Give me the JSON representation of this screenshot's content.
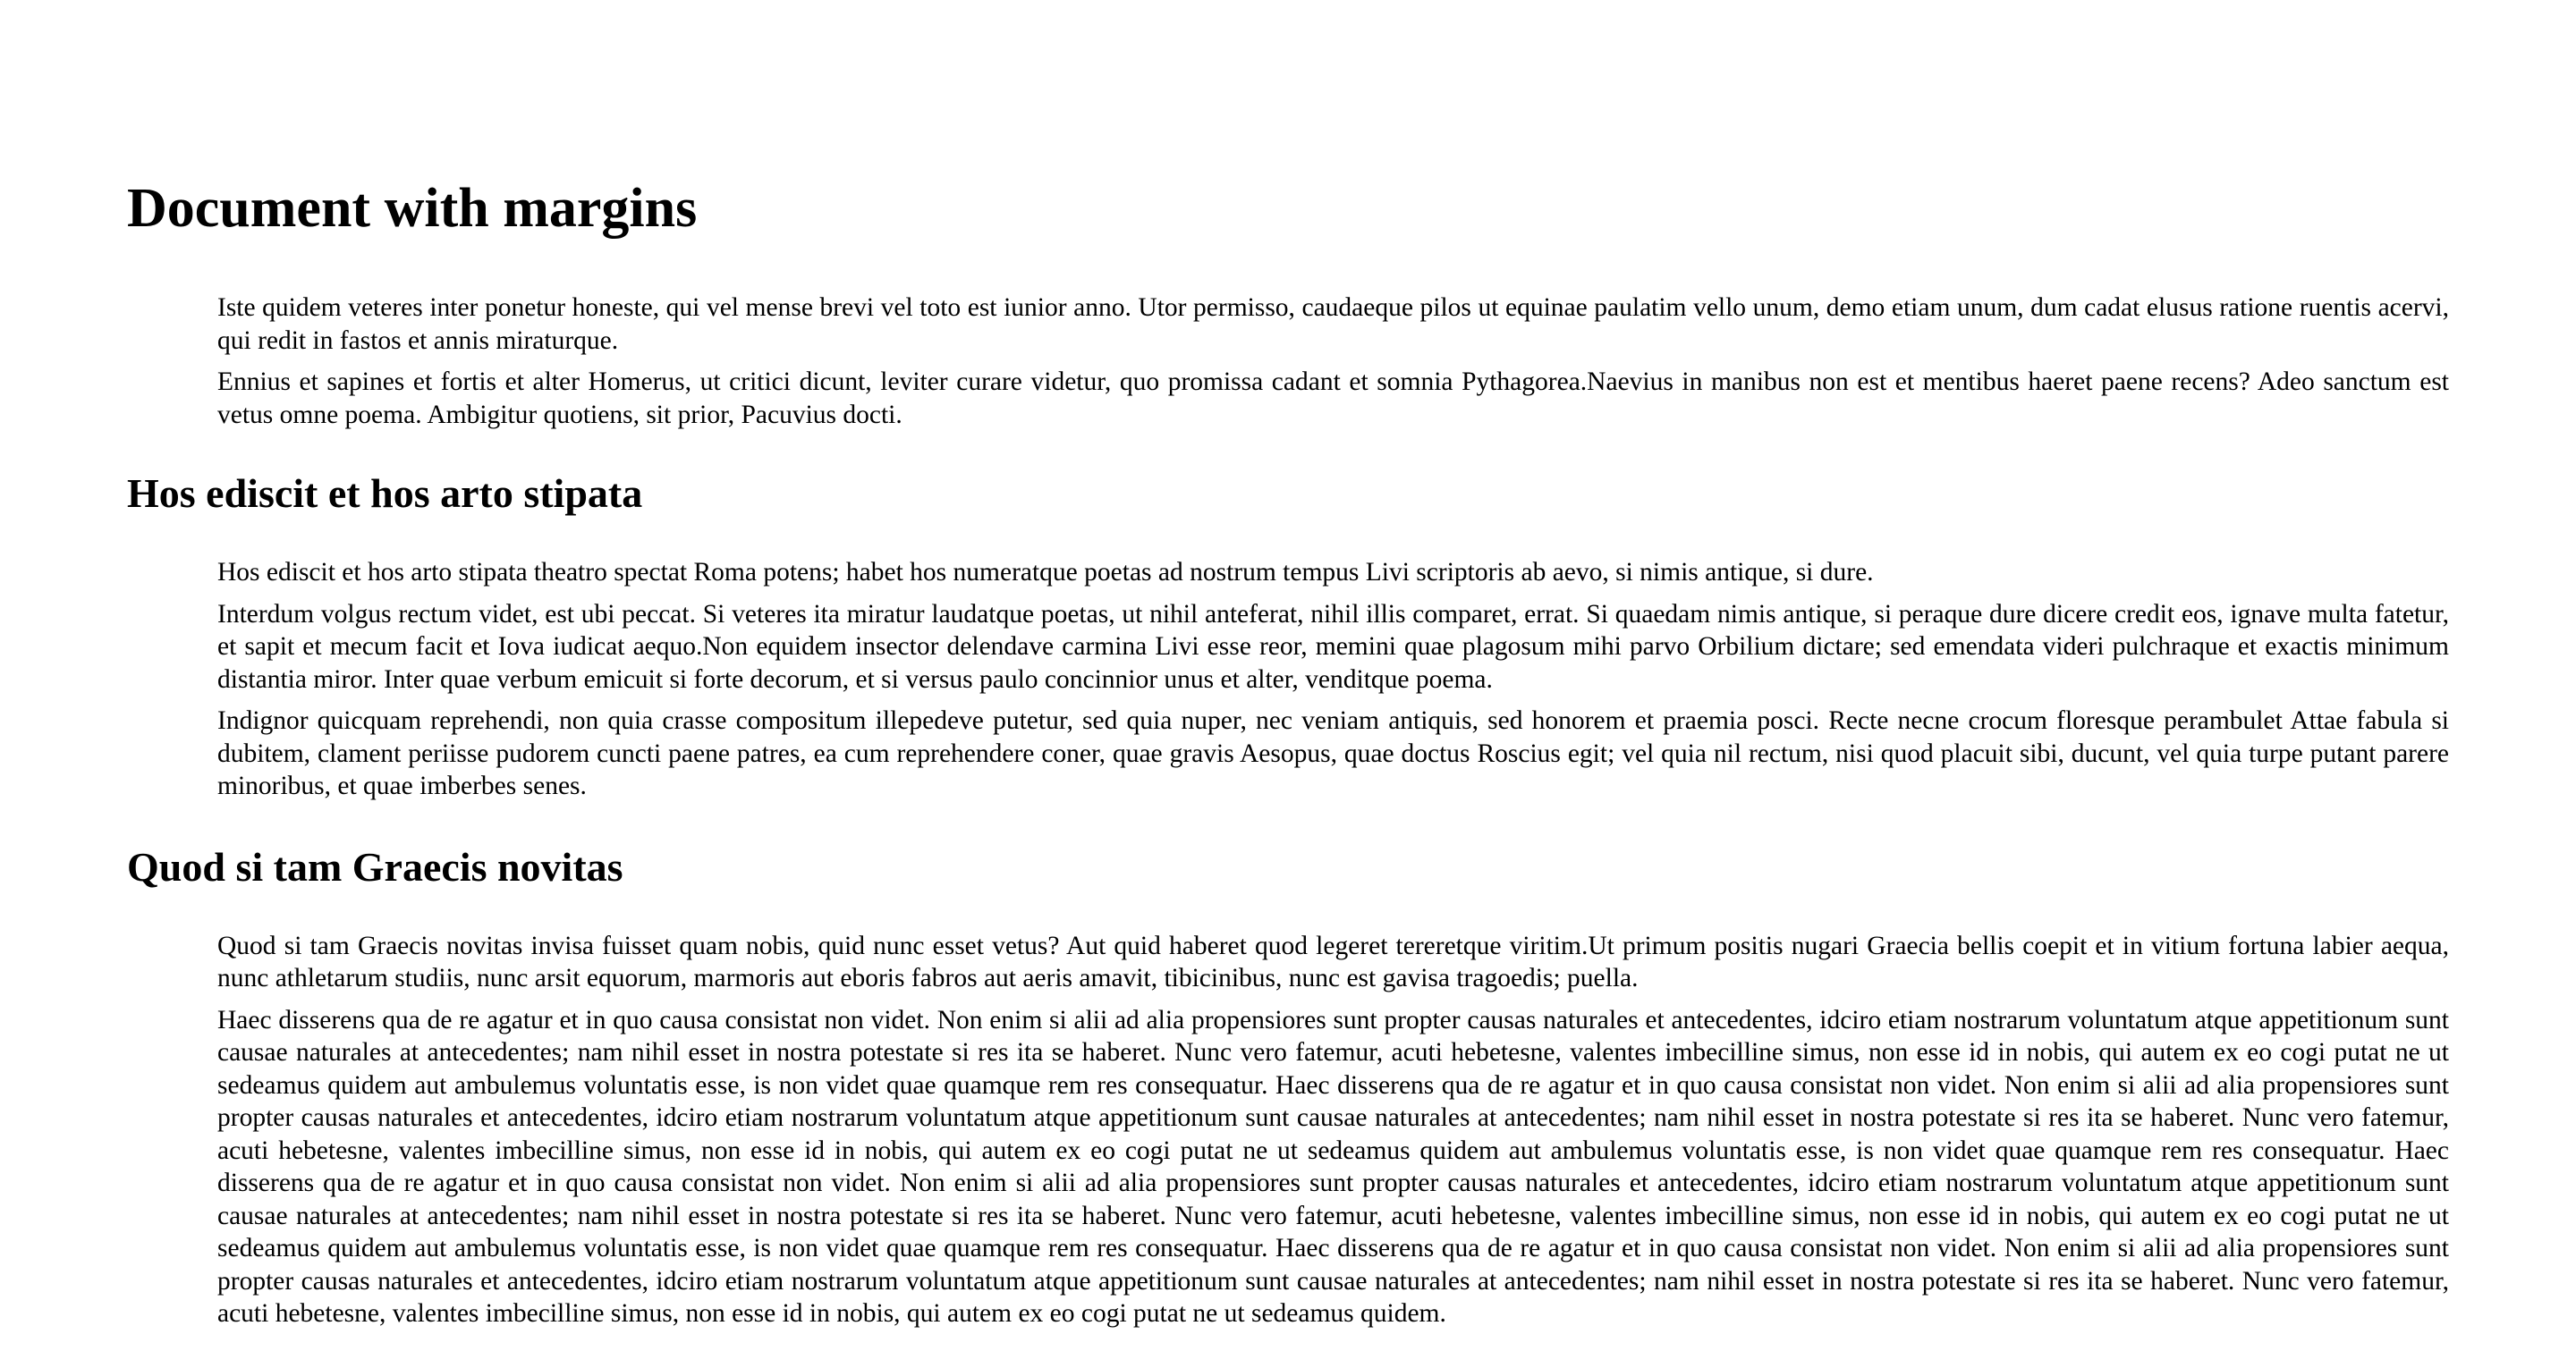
{
  "doc": {
    "title": "Document with margins",
    "intro": [
      "Iste quidem veteres inter ponetur honeste, qui vel mense brevi vel toto est iunior anno. Utor permisso, caudaeque pilos ut equinae paulatim vello unum, demo etiam unum, dum cadat elusus ratione ruentis acervi, qui redit in fastos et annis miraturque.",
      "Ennius et sapines et fortis et alter Homerus, ut critici dicunt, leviter curare videtur, quo promissa cadant et somnia Pythagorea.Naevius in manibus non est et mentibus haeret paene recens? Adeo sanctum est vetus omne poema. Ambigitur quotiens, sit prior, Pacuvius docti."
    ],
    "sections": [
      {
        "heading": "Hos ediscit et hos arto stipata",
        "paragraphs": [
          "Hos ediscit et hos arto stipata theatro spectat Roma potens; habet hos numeratque poetas ad nostrum tempus Livi scriptoris ab aevo, si nimis antique, si dure.",
          "Interdum volgus rectum videt, est ubi peccat. Si veteres ita miratur laudatque poetas, ut nihil anteferat, nihil illis comparet, errat. Si quaedam nimis antique, si peraque dure dicere credit eos, ignave multa fatetur, et sapit et mecum facit et Iova iudicat aequo.Non equidem insector delendave carmina Livi esse reor, memini quae plagosum mihi parvo Orbilium dictare; sed emendata videri pulchraque et exactis minimum distantia miror. Inter quae verbum emicuit si forte decorum, et si versus paulo concinnior unus et alter, venditque poema.",
          "Indignor quicquam reprehendi, non quia crasse compositum illepedeve putetur, sed quia nuper, nec veniam antiquis, sed honorem et praemia posci. Recte necne crocum floresque perambulet Attae fabula si dubitem, clament periisse pudorem cuncti paene patres, ea cum reprehendere coner, quae gravis Aesopus, quae doctus Roscius egit; vel quia nil rectum, nisi quod placuit sibi, ducunt, vel quia turpe putant parere minoribus, et quae imberbes senes."
        ]
      },
      {
        "heading": "Quod si tam Graecis novitas",
        "paragraphs": [
          "Quod si tam Graecis novitas invisa fuisset quam nobis, quid nunc esset vetus? Aut quid haberet quod legeret tereretque viritim.Ut primum positis nugari Graecia bellis coepit et in vitium fortuna labier aequa, nunc athletarum studiis, nunc arsit equorum, marmoris aut eboris fabros aut aeris amavit, tibicinibus, nunc est gavisa tragoedis; puella.",
          "Haec disserens qua de re agatur et in quo causa consistat non videt. Non enim si alii ad alia propensiores sunt propter causas naturales et antecedentes, idciro etiam nostrarum voluntatum atque appetitionum sunt causae naturales at antecedentes; nam nihil esset in nostra potestate si res ita se haberet. Nunc vero fatemur, acuti hebetesne, valentes imbecilline simus, non esse id in nobis, qui autem ex eo cogi putat ne ut sedeamus quidem aut ambulemus voluntatis esse, is non videt quae quamque rem res consequatur. Haec disserens qua de re agatur et in quo causa consistat non videt. Non enim si alii ad alia propensiores sunt propter causas naturales et antecedentes, idciro etiam nostrarum voluntatum atque appetitionum sunt causae naturales at antecedentes; nam nihil esset in nostra potestate si res ita se haberet. Nunc vero fatemur, acuti hebetesne, valentes imbecilline simus, non esse id in nobis, qui autem ex eo cogi putat ne ut sedeamus quidem aut ambulemus voluntatis esse, is non videt quae quamque rem res consequatur. Haec disserens qua de re agatur et in quo causa consistat non videt. Non enim si alii ad alia propensiores sunt propter causas naturales et antecedentes, idciro etiam nostrarum voluntatum atque appetitionum sunt causae naturales at antecedentes; nam nihil esset in nostra potestate si res ita se haberet. Nunc vero fatemur, acuti hebetesne, valentes imbecilline simus, non esse id in nobis, qui autem ex eo cogi putat ne ut sedeamus quidem aut ambulemus voluntatis esse, is non videt quae quamque rem res consequatur. Haec disserens qua de re agatur et in quo causa consistat non videt. Non enim si alii ad alia propensiores sunt propter causas naturales et antecedentes, idciro etiam nostrarum voluntatum atque appetitionum sunt causae naturales at antecedentes; nam nihil esset in nostra potestate si res ita se haberet. Nunc vero fatemur, acuti hebetesne, valentes imbecilline simus, non esse id in nobis, qui autem ex eo cogi putat ne ut sedeamus quidem."
        ]
      }
    ]
  }
}
